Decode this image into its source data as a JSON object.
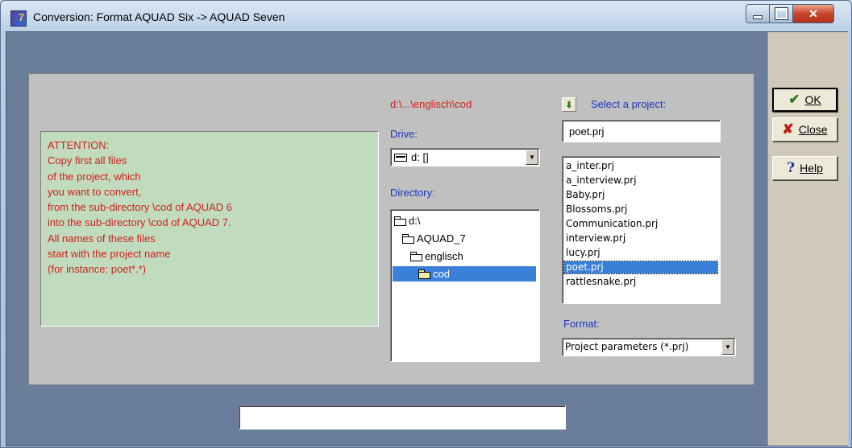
{
  "window": {
    "title": "Conversion: Format AQUAD Six -> AQUAD Seven",
    "controls": {
      "minimize": "minimize-icon",
      "maximize": "maximize-icon",
      "close": "close-icon"
    }
  },
  "attention": {
    "lines": [
      "ATTENTION:",
      "Copy first all files",
      "of the project, which",
      "you want to convert,",
      "from the sub-directory \\cod of AQUAD 6",
      "into the sub-directory \\cod of AQUAD 7.",
      "All names of these files",
      "start with the project name",
      "(for instance: poet*.*)"
    ]
  },
  "path_label": "d:\\...\\englisch\\cod",
  "drive": {
    "label": "Drive:",
    "value": "d: []"
  },
  "directory": {
    "label": "Directory:",
    "items": [
      {
        "name": "d:\\",
        "selected": false
      },
      {
        "name": "AQUAD_7",
        "selected": false
      },
      {
        "name": "englisch",
        "selected": false
      },
      {
        "name": "cod",
        "selected": true
      }
    ]
  },
  "project": {
    "label": "Select a project:",
    "value": "poet.prj",
    "files": [
      {
        "name": "a_inter.prj",
        "selected": false
      },
      {
        "name": "a_interview.prj",
        "selected": false
      },
      {
        "name": "Baby.prj",
        "selected": false
      },
      {
        "name": "Blossoms.prj",
        "selected": false
      },
      {
        "name": "Communication.prj",
        "selected": false
      },
      {
        "name": "interview.prj",
        "selected": false
      },
      {
        "name": "lucy.prj",
        "selected": false
      },
      {
        "name": "poet.prj",
        "selected": true
      },
      {
        "name": "rattlesnake.prj",
        "selected": false
      }
    ]
  },
  "format": {
    "label": "Format:",
    "value": "Project parameters (*.prj)"
  },
  "buttons": {
    "ok": "OK",
    "close": "Close",
    "help": "Help"
  },
  "status_value": "",
  "colors": {
    "accent_red": "#d0211a",
    "label_blue": "#1c36b8",
    "selection": "#3a7fd8",
    "attention_bg": "#c1dbbf"
  }
}
